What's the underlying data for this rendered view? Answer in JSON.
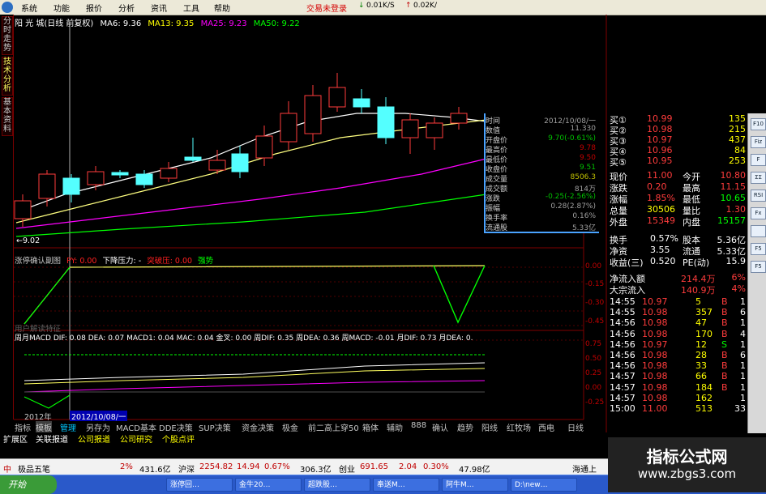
{
  "menu": {
    "items": [
      "系统",
      "功能",
      "报价",
      "分析",
      "资讯",
      "工具",
      "帮助"
    ],
    "status": "交易未登录",
    "down_speed": "0.01K/S",
    "up_speed": "0.02K/"
  },
  "left_tabs": [
    "分时走势",
    "技术分析",
    "基本资料"
  ],
  "chart_header": {
    "title": "阳 光 城(日线 前复权)",
    "ma6": "MA6: 9.36",
    "ma13": "MA13: 9.35",
    "ma25": "MA25: 9.23",
    "ma50": "MA50: 9.22"
  },
  "colors": {
    "up": "#ff3c3c",
    "down": "#54ffff",
    "ma6": "#ffffff",
    "ma13": "#ffff00",
    "ma25": "#ff00ff",
    "ma50": "#00ff00",
    "grid": "#800000"
  },
  "price_low_label": "9.02",
  "sub1": {
    "name": "涨停确认副图",
    "py": "PY: 0.00",
    "pressure": "下降压力: -",
    "break": "突破压: 0.00",
    "strong": "强势",
    "axis": [
      "0.00",
      "-0.15",
      "-0.30",
      "-0.45"
    ],
    "footer": "用户解读特征"
  },
  "sub2": {
    "text": "周月MACD DIF: 0.08 DEA: 0.07 MACD1: 0.04 MAC: 0.04 金叉: 0.00 周DIF: 0.35 周DEA: 0.36 周MACD: -0.01 月DIF: 0.73 月DEA: 0.",
    "axis": [
      "0.75",
      "0.50",
      "0.25",
      "0.00",
      "-0.25"
    ],
    "date": "2012/10/08/一",
    "year": "2012年"
  },
  "tooltip": [
    {
      "k": "时间",
      "v": "2012/10/08/一"
    },
    {
      "k": "数值",
      "v": "11.330"
    },
    {
      "k": "开盘价",
      "v": "9.70(-0.61%)"
    },
    {
      "k": "最高价",
      "v": "9.78"
    },
    {
      "k": "最低价",
      "v": "9.50"
    },
    {
      "k": "收盘价",
      "v": "9.51"
    },
    {
      "k": "成交量",
      "v": "8506.3"
    },
    {
      "k": "成交额",
      "v": "814万"
    },
    {
      "k": "涨跌",
      "v": "-0.25(-2.56%)"
    },
    {
      "k": "振幅",
      "v": "0.28(2.87%)"
    },
    {
      "k": "换手率",
      "v": "0.16%"
    },
    {
      "k": "流通股",
      "v": "5.33亿"
    }
  ],
  "quote": {
    "buys": [
      {
        "label": "买①",
        "price": "10.99",
        "vol": "135"
      },
      {
        "label": "买②",
        "price": "10.98",
        "vol": "215"
      },
      {
        "label": "买③",
        "price": "10.97",
        "vol": "437"
      },
      {
        "label": "买④",
        "price": "10.96",
        "vol": "84"
      },
      {
        "label": "买⑤",
        "price": "10.95",
        "vol": "253"
      }
    ],
    "stats": [
      [
        "现价",
        "11.00",
        "今开",
        "10.80"
      ],
      [
        "涨跌",
        "0.20",
        "最高",
        "11.15"
      ],
      [
        "涨幅",
        "1.85%",
        "最低",
        "10.65"
      ],
      [
        "总量",
        "30506",
        "量比",
        "1.30"
      ],
      [
        "外盘",
        "15349",
        "内盘",
        "15157"
      ]
    ],
    "stats2": [
      [
        "换手",
        "0.57%",
        "股本",
        "5.36亿"
      ],
      [
        "净资",
        "3.55",
        "流通",
        "5.33亿"
      ],
      [
        "收益(三)",
        "0.520",
        "PE(动)",
        "15.9"
      ]
    ],
    "flows": [
      [
        "净流入额",
        "214.4万",
        "6%"
      ],
      [
        "大宗流入",
        "140.9万",
        "4%"
      ]
    ],
    "ticks": [
      [
        "14:55",
        "10.97",
        "5",
        "B"
      ],
      [
        "14:55",
        "10.98",
        "357",
        "B"
      ],
      [
        "14:56",
        "10.98",
        "47",
        "B"
      ],
      [
        "14:56",
        "10.98",
        "170",
        "B"
      ],
      [
        "14:56",
        "10.97",
        "12",
        "S"
      ],
      [
        "14:56",
        "10.98",
        "28",
        "B"
      ],
      [
        "14:56",
        "10.98",
        "33",
        "B"
      ],
      [
        "14:57",
        "10.98",
        "66",
        "B"
      ],
      [
        "14:57",
        "10.98",
        "184",
        "B"
      ],
      [
        "14:57",
        "10.98",
        "162",
        ""
      ],
      [
        "15:00",
        "11.00",
        "513",
        ""
      ]
    ],
    "tick_side_col": [
      "1",
      "6",
      "1",
      "4",
      "1",
      "6",
      "1",
      "1",
      "1",
      "1",
      "33"
    ]
  },
  "icon_strip": [
    "F10",
    "Fiz",
    "F",
    "ΣΣ",
    "RSI",
    "Fx",
    "",
    "F5",
    "F5"
  ],
  "bottom_tabs": [
    "指标",
    "模板",
    "管理",
    "另存为",
    "MACD基本",
    "DDE决策",
    "SUP决策",
    "资金决策",
    "极金",
    "前二高",
    "上穿50",
    "箱体",
    "辅助",
    "888",
    "确认",
    "趋势",
    "阳线",
    "红牧场",
    "西电"
  ],
  "right_tabs": [
    "日线"
  ],
  "tabs2": [
    "扩展区",
    "关联报道",
    "公司报道",
    "公司研究",
    "个股点评"
  ],
  "ticker": {
    "brand": "极品五笔",
    "a": "2%",
    "b": "431.6亿",
    "c": "沪深",
    "d": "2254.82",
    "e": "14.94",
    "f": "0.67%",
    "g": "306.3亿",
    "h": "创业",
    "i": "691.65",
    "j": "2.04",
    "k": "0.30%",
    "l": "47.98亿",
    "m": "海通上"
  },
  "taskbar": {
    "start": "开始",
    "tasks": [
      "涨停回…",
      "金牛20…",
      "超跌股…",
      "奉送M…",
      "阿牛M…",
      "D:\\new…"
    ]
  },
  "watermark": {
    "line1": "指标公式网",
    "line2": "www.zbgs3.com"
  }
}
